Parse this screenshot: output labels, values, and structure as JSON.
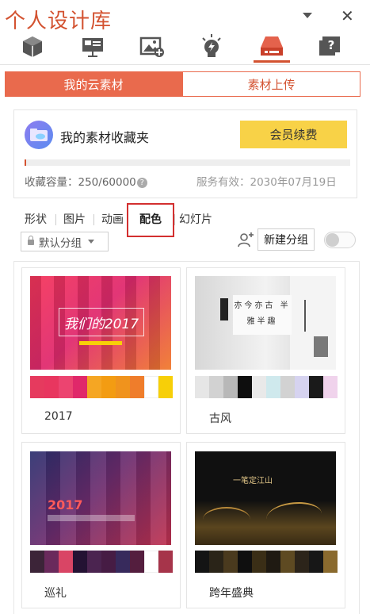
{
  "app": {
    "title": "个人设计库"
  },
  "toolbar": {
    "icons": [
      "cube-icon",
      "slide-icon",
      "image-add-icon",
      "bulb-icon",
      "drive-icon",
      "help-icon"
    ],
    "active_index": 4,
    "accent": "#d35230"
  },
  "tabs": {
    "cloud": "我的云素材",
    "upload": "素材上传"
  },
  "folder": {
    "title": "我的素材收藏夹",
    "vip_button": "会员续费",
    "capacity_label": "收藏容量：",
    "capacity_value": "250/60000",
    "capacity_ratio": 0.004167,
    "service_text": "服务有效：2030年07月19日"
  },
  "categories": [
    "形状",
    "图片",
    "动画",
    "配色",
    "幻灯片"
  ],
  "active_category": "配色",
  "group_select": {
    "value": "默认分组"
  },
  "new_group_button": "新建分组",
  "palettes": [
    {
      "label": "2017",
      "thumb_text": "我们的2017",
      "colors": [
        "#e63a5e",
        "#e8365f",
        "#ec4470",
        "#e0286a",
        "#f5a623",
        "#f39c12",
        "#f0931d",
        "#ef7d2b",
        "#ffffff",
        "#f7cf08"
      ]
    },
    {
      "label": "古风",
      "thumb_text": "亦今亦古 半雅半趣",
      "colors": [
        "#e6e6e6",
        "#d2d2d2",
        "#b8b8b8",
        "#0e0e0e",
        "#e9e9e9",
        "#cfe9ed",
        "#d2d2d2",
        "#d6d3f0",
        "#1a1a1a",
        "#f0d3ec"
      ]
    },
    {
      "label": "巡礼",
      "thumb_text": "2017",
      "colors": [
        "#3c2438",
        "#6a2a5c",
        "#d94565",
        "#241233",
        "#4b2450",
        "#461c44",
        "#372a5c",
        "#541e3e",
        "#ffffff",
        "#a6344a"
      ]
    },
    {
      "label": "跨年盛典",
      "thumb_text": "一笔定江山",
      "colors": [
        "#141414",
        "#2a2418",
        "#4a3a1e",
        "#0f0f0f",
        "#3a2e16",
        "#1f1a12",
        "#5e4a22",
        "#2c241a",
        "#171717",
        "#8a6a2e"
      ]
    }
  ]
}
